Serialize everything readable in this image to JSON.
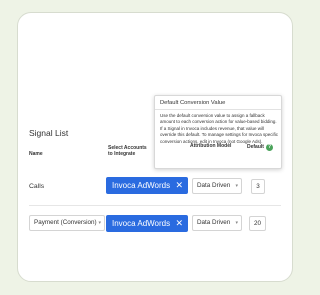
{
  "tooltip": {
    "title": "Default Conversion Value",
    "body": "Use the default conversion value to assign a fallback amount to each conversion action for value-based bidding. If a Signal in Invoca includes revenue, that value will override this default. To manage settings for Invoca specific conversion actions, edit in Invoca (not Google Ads)."
  },
  "section_title": "Signal List",
  "columns": {
    "name": "Name",
    "accounts_line1": "Select Accounts",
    "accounts_line2": "to Integrate",
    "attribution": "Attribution Model",
    "default": "Default"
  },
  "help_icon": "question-icon",
  "rows": [
    {
      "name": "Calls",
      "account": "Invoca AdWords",
      "attribution": "Data Driven",
      "default_value": "3"
    },
    {
      "name": "Payment (Conversion)",
      "account": "Invoca AdWords",
      "attribution": "Data Driven",
      "default_value": "20"
    }
  ],
  "colors": {
    "accent": "#2a6be0",
    "help_icon": "#4aa35a",
    "page_bg": "#eef3e6"
  }
}
